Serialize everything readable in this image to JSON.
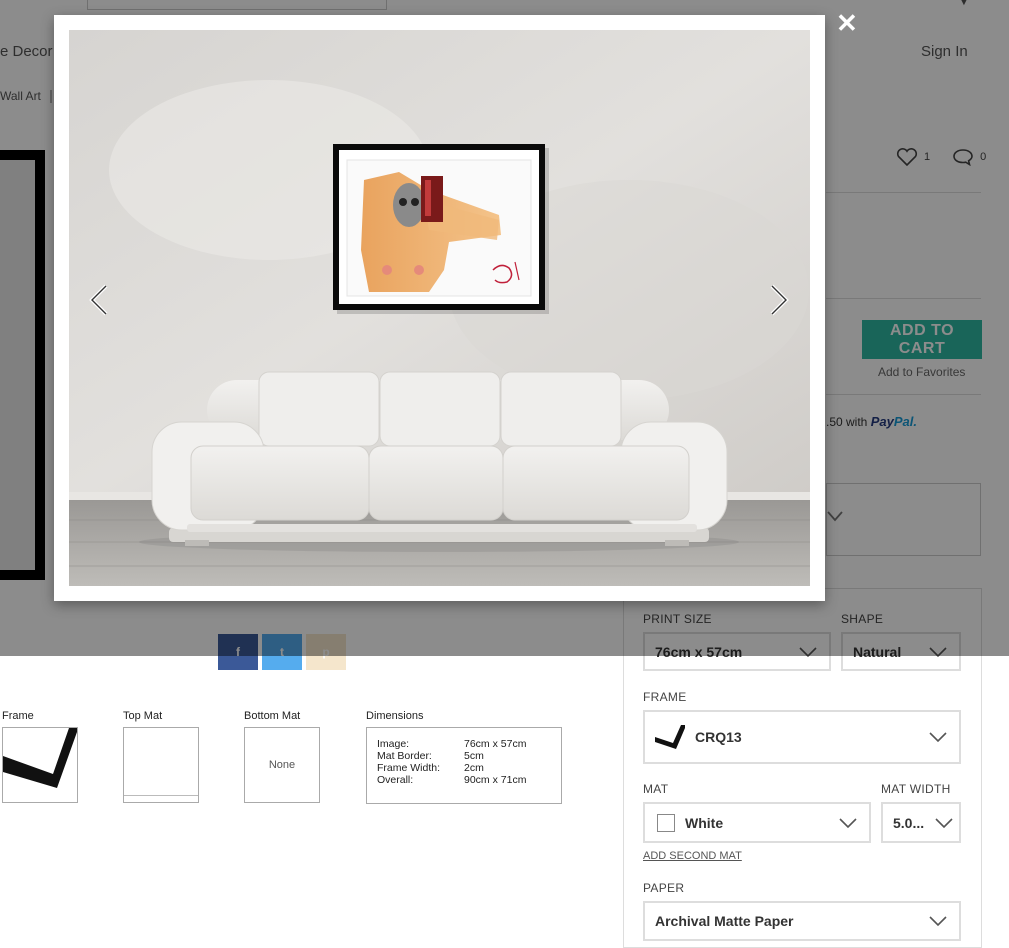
{
  "header": {
    "nav_partial": "e Decor",
    "breadcrumb_partial": "Wall Art",
    "sign_in": "Sign In"
  },
  "stats": {
    "likes": "1",
    "comments": "0"
  },
  "purchase": {
    "add_to_cart": "ADD TO CART",
    "add_to_favorites": "Add to Favorites",
    "paypal_prefix": ".50 with",
    "paypal_brand_1": "Pay",
    "paypal_brand_2": "Pal."
  },
  "social": {
    "facebook": "f",
    "twitter": "t",
    "pinterest": "p"
  },
  "thumbs": {
    "frame_label": "Frame",
    "top_mat_label": "Top Mat",
    "bottom_mat_label": "Bottom Mat",
    "bottom_mat_value": "None",
    "dimensions_label": "Dimensions",
    "dimensions": [
      {
        "key": "Image:",
        "value": "76cm x 57cm"
      },
      {
        "key": "Mat Border:",
        "value": "5cm"
      },
      {
        "key": "Frame Width:",
        "value": "2cm"
      },
      {
        "key": "Overall:",
        "value": "90cm x 71cm"
      }
    ]
  },
  "options": {
    "print_size_label": "PRINT SIZE",
    "print_size_value": "76cm x 57cm",
    "shape_label": "SHAPE",
    "shape_value": "Natural",
    "frame_label": "FRAME",
    "frame_value": "CRQ13",
    "mat_label": "MAT",
    "mat_value": "White",
    "mat_width_label": "MAT WIDTH",
    "mat_width_value": "5.0...",
    "add_second_mat": "ADD SECOND MAT",
    "paper_label": "PAPER",
    "paper_value": "Archival Matte Paper"
  },
  "lightbox": {
    "close": "✕"
  },
  "colors": {
    "accent": "#2fb9a2",
    "facebook": "#3b5998",
    "twitter": "#55acee",
    "pinterest": "#cb2027"
  }
}
